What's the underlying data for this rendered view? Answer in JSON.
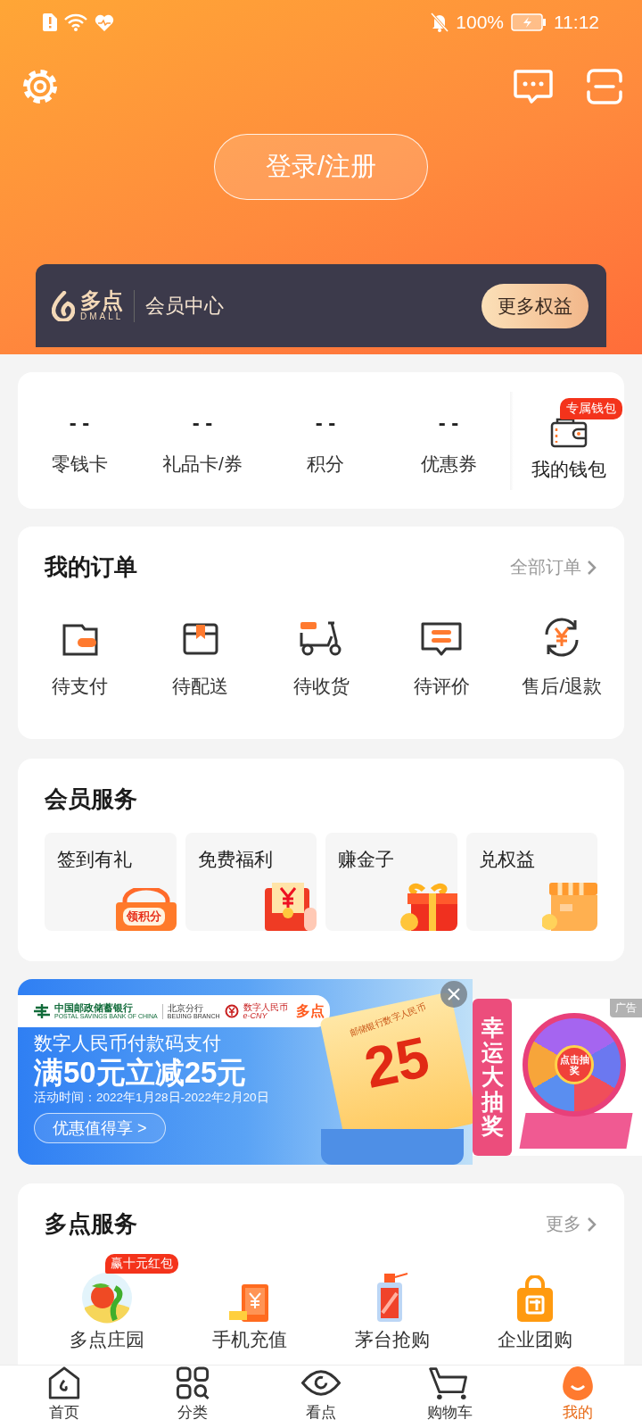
{
  "status_bar": {
    "battery": "100%",
    "time": "11:12"
  },
  "header": {
    "login_button": "登录/注册"
  },
  "member_bar": {
    "logo_text": "多点",
    "logo_sub": "DMALL",
    "title": "会员中心",
    "button": "更多权益"
  },
  "wallet": {
    "stats": [
      {
        "value": "- -",
        "label": "零钱卡"
      },
      {
        "value": "- -",
        "label": "礼品卡/券"
      },
      {
        "value": "- -",
        "label": "积分"
      },
      {
        "value": "- -",
        "label": "优惠券"
      }
    ],
    "badge": "专属钱包",
    "label": "我的钱包"
  },
  "orders": {
    "title": "我的订单",
    "more": "全部订单",
    "items": [
      {
        "kind": "pay",
        "label": "待支付"
      },
      {
        "kind": "box",
        "label": "待配送"
      },
      {
        "kind": "scooter",
        "label": "待收货"
      },
      {
        "kind": "review",
        "label": "待评价"
      },
      {
        "kind": "refund",
        "label": "售后/退款"
      }
    ]
  },
  "member_services": {
    "title": "会员服务",
    "tiles": [
      {
        "kind": "basket",
        "label": "签到有礼",
        "badge": "领积分"
      },
      {
        "kind": "envelope",
        "label": "免费福利"
      },
      {
        "kind": "gift",
        "label": "赚金子"
      },
      {
        "kind": "shop",
        "label": "兑权益"
      }
    ]
  },
  "banner": {
    "bank_name": "中国邮政储蓄银行",
    "bank_name_en": "POSTAL SAVINGS BANK OF CHINA",
    "branch": "北京分行",
    "branch_en": "BEIJING BRANCH",
    "ecny": "数字人民币",
    "ecny_en": "e-CNY",
    "partner": "多点",
    "headline": "数字人民币付款码支付",
    "offer": "满50元立减25元",
    "period": "活动时间：2022年1月28日-2022年2月20日",
    "cta": "优惠值得享 >",
    "ticket_title": "邮储银行数字人民币",
    "ticket_amount": "25"
  },
  "lottery_ad": {
    "title": "幸运大抽奖",
    "wheel_button": "点击抽奖",
    "ad_label": "广告"
  },
  "services": {
    "title": "多点服务",
    "more": "更多",
    "items": [
      {
        "kind": "farm",
        "label": "多点庄园",
        "badge": "赢十元红包"
      },
      {
        "kind": "phone",
        "label": "手机充值"
      },
      {
        "kind": "bottle",
        "label": "茅台抢购"
      },
      {
        "kind": "group",
        "label": "企业团购"
      }
    ]
  },
  "nav": [
    {
      "kind": "home",
      "label": "首页",
      "selected": false
    },
    {
      "kind": "category",
      "label": "分类",
      "selected": false
    },
    {
      "kind": "watch",
      "label": "看点",
      "selected": false
    },
    {
      "kind": "cart",
      "label": "购物车",
      "selected": false
    },
    {
      "kind": "me",
      "label": "我的",
      "selected": true
    }
  ]
}
